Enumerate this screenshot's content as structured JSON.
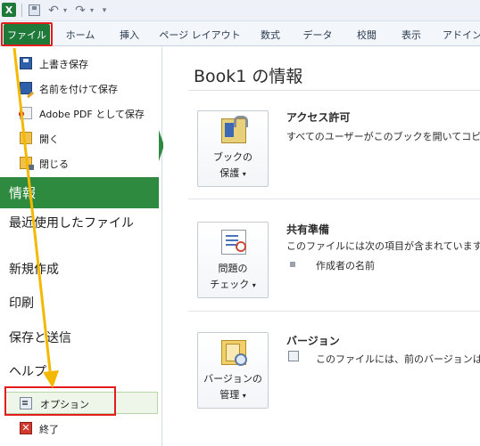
{
  "quick_access": {
    "logo": "X",
    "icons": [
      "excel-logo",
      "save-icon",
      "undo-icon",
      "redo-icon",
      "customize-icon"
    ]
  },
  "ribbon": {
    "tabs": [
      "ファイル",
      "ホーム",
      "挿入",
      "ページ レイアウト",
      "数式",
      "データ",
      "校閲",
      "表示",
      "アドイン"
    ]
  },
  "backstage": {
    "commands": {
      "save": "上書き保存",
      "save_as": "名前を付けて保存",
      "save_pdf": "Adobe PDF として保存",
      "open": "開く",
      "close": "閉じる",
      "options": "オプション",
      "exit": "終了"
    },
    "tabs": {
      "info": "情報",
      "recent": "最近使用したファイル",
      "new": "新規作成",
      "print": "印刷",
      "share": "保存と送信",
      "help": "ヘルプ"
    }
  },
  "info": {
    "title": "Book1 の情報",
    "sections": [
      {
        "button_line1": "ブックの",
        "button_line2": "保護",
        "heading": "アクセス許可",
        "text": "すべてのユーザーがこのブックを開いてコピー"
      },
      {
        "button_line1": "問題の",
        "button_line2": "チェック",
        "heading": "共有準備",
        "text": "このファイルには次の項目が含まれています",
        "item": "作成者の名前"
      },
      {
        "button_line1": "バージョンの",
        "button_line2": "管理",
        "heading": "バージョン",
        "text": "このファイルには、前のバージョンはあ"
      }
    ]
  },
  "colors": {
    "file_tab": "#1f7a3a",
    "active_nav": "#2d8a3e",
    "highlight_box": "#e31c1c",
    "arrow": "#f5b800"
  }
}
